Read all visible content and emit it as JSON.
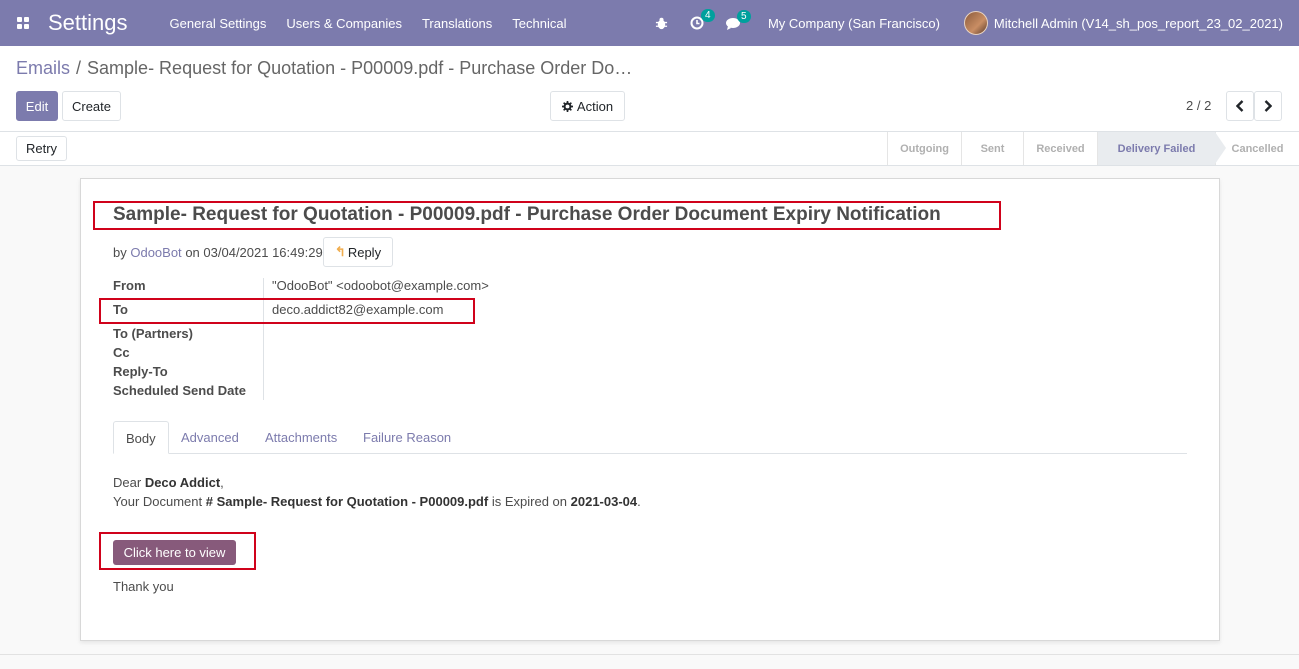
{
  "navbar": {
    "app_title": "Settings",
    "menu": [
      "General Settings",
      "Users & Companies",
      "Translations",
      "Technical"
    ],
    "activity_count": "4",
    "message_count": "5",
    "company": "My Company (San Francisco)",
    "user": "Mitchell Admin (V14_sh_pos_report_23_02_2021)",
    "icons": [
      "apps-icon",
      "bug-icon",
      "clock-icon",
      "chat-icon"
    ],
    "colors": {
      "primary": "#7c7bad",
      "badge": "#00a09d"
    }
  },
  "control_panel": {
    "breadcrumb": {
      "parent": "Emails",
      "separator": "/",
      "current": "Sample- Request for Quotation - P00009.pdf - Purchase Order Do…"
    },
    "edit_label": "Edit",
    "create_label": "Create",
    "action_label": "Action",
    "pager": "2 / 2"
  },
  "statusbar": {
    "retry_label": "Retry",
    "stages": [
      "Outgoing",
      "Sent",
      "Received",
      "Delivery Failed",
      "Cancelled"
    ],
    "active_stage": "Delivery Failed"
  },
  "mail": {
    "subject": "Sample- Request for Quotation - P00009.pdf - Purchase Order Document Expiry Notification",
    "by": "by",
    "author": "OdooBot",
    "date_prefix": "on",
    "date": "03/04/2021 16:49:29",
    "reply_label": "Reply",
    "fields": {
      "from_label": "From",
      "from_value": "\"OdooBot\" <odoobot@example.com>",
      "to_label": "To",
      "to_value": "deco.addict82@example.com",
      "to_partners_label": "To (Partners)",
      "cc_label": "Cc",
      "reply_to_label": "Reply-To",
      "scheduled_label": "Scheduled Send Date"
    },
    "tabs": [
      "Body",
      "Advanced",
      "Attachments",
      "Failure Reason"
    ],
    "body": {
      "greeting": "Dear",
      "customer": "Deco Addict",
      "comma": ",",
      "line_prefix": "Your Document",
      "document": "# Sample- Request for Quotation - P00009.pdf",
      "middle": "is Expired on",
      "expiry_date": "2021-03-04",
      "period": ".",
      "view_button": "Click here to view",
      "thanks": "Thank you"
    }
  }
}
